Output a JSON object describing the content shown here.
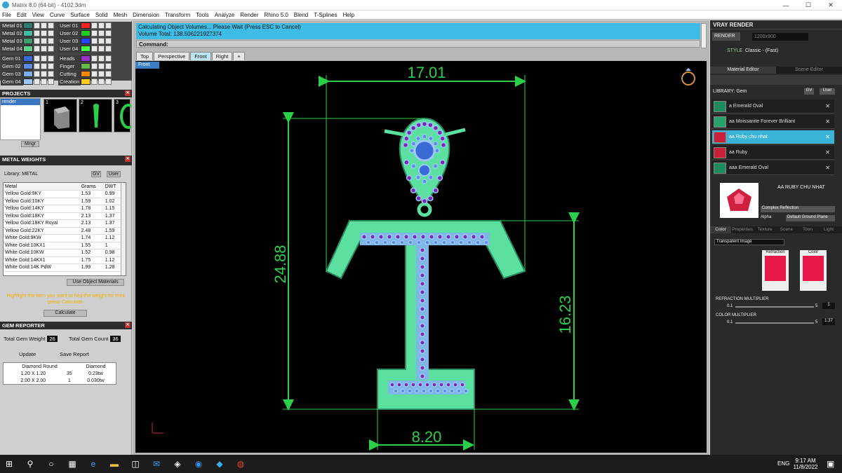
{
  "window": {
    "title": "Matrix 8.0 (64-bit) - 4102.3dm",
    "min": "—",
    "max": "☐",
    "close": "✕"
  },
  "menu": [
    "File",
    "Edit",
    "View",
    "Curve",
    "Surface",
    "Solid",
    "Mesh",
    "Dimension",
    "Transform",
    "Tools",
    "Analyze",
    "Render",
    "Rhino 5.0",
    "Blend",
    "T-Splines",
    "Help"
  ],
  "swatches_left": [
    {
      "label": "Metal 01",
      "color": "#2e7d6e"
    },
    {
      "label": "Metal 02",
      "color": "#3fbfa0"
    },
    {
      "label": "Metal 03",
      "color": "#3aa070"
    },
    {
      "label": "Metal 04",
      "color": "#5fd08a"
    },
    {
      "label": "Gem 01",
      "color": "#3a6ad6"
    },
    {
      "label": "Gem 02",
      "color": "#5a8ae6"
    },
    {
      "label": "Gem 03",
      "color": "#7aaef0"
    },
    {
      "label": "Gem 04",
      "color": "#9cc8f8"
    }
  ],
  "swatches_right": [
    {
      "label": "User 01",
      "color": "#ff2222"
    },
    {
      "label": "User 02",
      "color": "#22cc22"
    },
    {
      "label": "User 03",
      "color": "#2244ff"
    },
    {
      "label": "User 04",
      "color": "#44ff44"
    },
    {
      "label": "Heads",
      "color": "#9933cc"
    },
    {
      "label": "Finger",
      "color": "#66bb44"
    },
    {
      "label": "Cutting",
      "color": "#ff8800"
    },
    {
      "label": "Creation",
      "color": "#ffcc22"
    }
  ],
  "projects": {
    "title": "PROJECTS",
    "items": [
      "render"
    ],
    "thumbs": [
      "1",
      "2",
      "3"
    ],
    "mngr": "Mngr"
  },
  "metal_weights": {
    "title": "METAL WEIGHTS",
    "library": "Library: METAL",
    "gv": "GV",
    "user": "User",
    "headers": [
      "Metal",
      "Grams",
      "DWT"
    ],
    "rows": [
      [
        "Yellow Gold:9KY",
        "1.53",
        "0.99"
      ],
      [
        "Yellow Gold:10KY",
        "1.59",
        "1.02"
      ],
      [
        "Yellow Gold:14KY",
        "1.78",
        "1.15"
      ],
      [
        "Yellow Gold:18KY",
        "2.13",
        "1.37"
      ],
      [
        "Yellow Gold:18KY Royal",
        "2.13",
        "1.37"
      ],
      [
        "Yellow Gold:22KY",
        "2.48",
        "1.59"
      ],
      [
        "White Gold:9KW",
        "1.74",
        "1.12"
      ],
      [
        "White Gold:10KX1",
        "1.55",
        "1"
      ],
      [
        "White Gold:10KW",
        "1.52",
        "0.98"
      ],
      [
        "White Gold:14KX1",
        "1.75",
        "1.12"
      ],
      [
        "White Gold:14K PdW",
        "1.99",
        "1.28"
      ]
    ],
    "use_object": "Use Object Materials",
    "hint": "Highlight the item you want to find the weight for then press Calculate.",
    "calculate": "Calculate"
  },
  "gem_reporter": {
    "title": "GEM REPORTER",
    "total_weight_label": "Total Gem Weight",
    "total_weight": "26",
    "total_count_label": "Total Gem Count",
    "total_count": "36",
    "update": "Update",
    "save": "Save Report",
    "head": [
      "Diamond Round",
      "Diamond"
    ],
    "rows": [
      [
        "1.20 X 1.20",
        "35",
        "0.23tw"
      ],
      [
        "2.00 X 2.00",
        "1",
        "0.030tw"
      ]
    ]
  },
  "command": {
    "line1": "Calculating Object Volumes... Please Wait (Press ESC to Cancel)",
    "line2": "Volume Total: 138.506221927374",
    "prompt": "Command:"
  },
  "tabs": [
    "Top",
    "Perspective",
    "Front",
    "Right"
  ],
  "viewport_label": "Front",
  "dims": {
    "top": "17.01",
    "left": "24.88",
    "right": "16.23",
    "bottom": "8.20"
  },
  "vray": {
    "title": "VRAY RENDER",
    "render": "RENDER",
    "res": "1200x900",
    "style_label": "STYLE",
    "style": "Classic - (Fast)",
    "tab1": "Material Editor",
    "tab2": "Scene Editor",
    "library": "LIBRARY: Gem",
    "gv": "GV",
    "user": "User",
    "items": [
      {
        "name": "a Emerald Oval",
        "color": "#1f8a5a"
      },
      {
        "name": "aa Moissanite Forever Brilliant",
        "color": "#2aa06a"
      },
      {
        "name": "aa Ruby chu nhat",
        "color": "#c8203a"
      },
      {
        "name": "aa Ruby",
        "color": "#c8203a"
      },
      {
        "name": "aaa Emerald Oval",
        "color": "#1f8a5a"
      }
    ],
    "selected_name": "AA RUBY CHU NHAT",
    "complex": "Complex Reflection",
    "alpha": "Alpha",
    "ground": "Default Ground Plane",
    "subtabs": [
      "Color",
      "Properties",
      "Texture",
      "Scene",
      "Toon",
      "Light"
    ],
    "transparent": "Transparent Image",
    "refraction": "Refraction",
    "color": "Color",
    "refr_mult": "REFRACTION MULTIPLIER",
    "refr_min": "0.1",
    "refr_max": "5",
    "refr_val": "1",
    "color_mult": "COLOR MULTIPLIER",
    "col_min": "0.1",
    "col_max": "5",
    "col_val": "1.37"
  },
  "taskbar": {
    "time": "9:17 AM",
    "date": "11/8/2022",
    "lang": "ENG"
  }
}
